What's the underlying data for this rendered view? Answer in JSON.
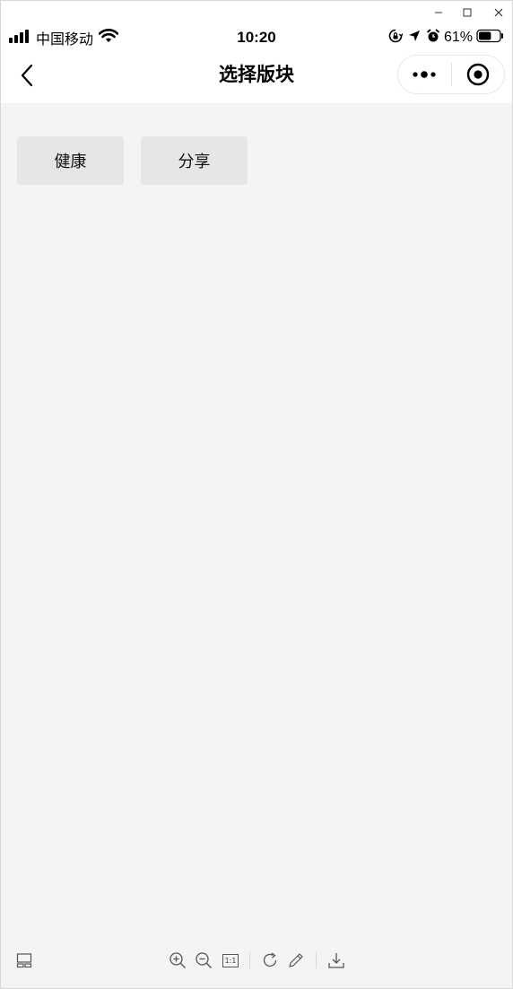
{
  "window": {
    "controls": [
      "minimize-icon",
      "maximize-icon",
      "close-icon"
    ]
  },
  "status_bar": {
    "carrier": "中国移动",
    "time": "10:20",
    "battery_percent": "61%",
    "battery_level": 0.61,
    "icons": [
      "signal-icon",
      "wifi-icon",
      "orientation-lock-icon",
      "location-icon",
      "alarm-icon",
      "battery-icon"
    ]
  },
  "nav": {
    "title": "选择版块",
    "back_icon": "back-chevron-icon",
    "capsule_icons": [
      "more-icon",
      "close-miniprogram-icon"
    ]
  },
  "categories": [
    {
      "label": "健康"
    },
    {
      "label": "分享"
    }
  ],
  "bottom_toolbar": {
    "icons": [
      "layout-icon",
      "zoom-in-icon",
      "zoom-out-icon",
      "actual-size-icon",
      "rotate-icon",
      "edit-icon",
      "download-icon"
    ],
    "actual_size_label": "1:1"
  },
  "colors": {
    "page_background": "#f4f4f4",
    "button_background": "#e6e6e6",
    "bar_background": "#ffffff"
  }
}
